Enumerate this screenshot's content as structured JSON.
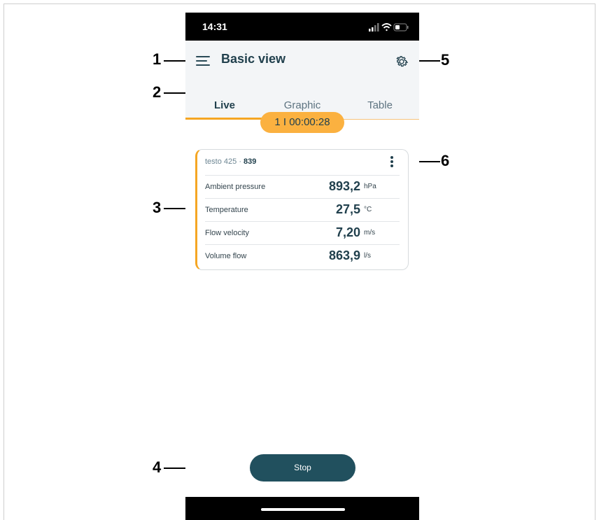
{
  "status_bar": {
    "time": "14:31"
  },
  "header": {
    "title": "Basic view"
  },
  "tabs": [
    {
      "label": "Live"
    },
    {
      "label": "Graphic"
    },
    {
      "label": "Table"
    }
  ],
  "timer": {
    "text": "1 I 00:00:28"
  },
  "card": {
    "device_name": "testo 425 · ",
    "device_serial": "839",
    "rows": [
      {
        "label": "Ambient pressure",
        "value": "893,2",
        "unit": "hPa"
      },
      {
        "label": "Temperature",
        "value": "27,5",
        "unit": "°C"
      },
      {
        "label": "Flow velocity",
        "value": "7,20",
        "unit": "m/s"
      },
      {
        "label": "Volume flow",
        "value": "863,9",
        "unit": "l/s"
      }
    ]
  },
  "stop_label": "Stop",
  "callouts": [
    "1",
    "2",
    "3",
    "4",
    "5",
    "6"
  ],
  "colors": {
    "accent": "#f5a623",
    "primary": "#21404d",
    "button": "#21505e"
  }
}
